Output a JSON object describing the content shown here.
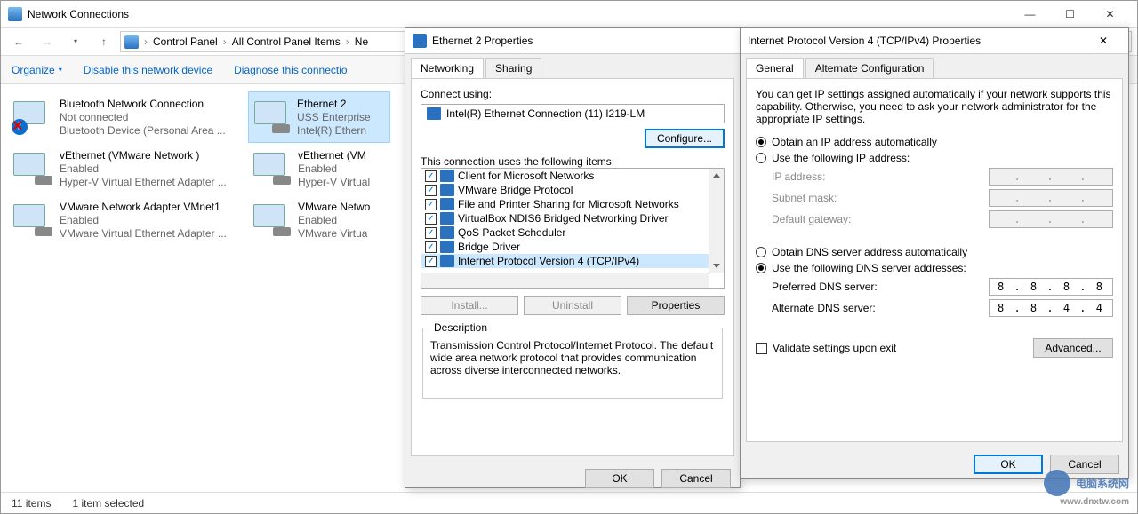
{
  "window": {
    "title": "Network Connections",
    "breadcrumb": [
      "Control Panel",
      "All Control Panel Items",
      "Ne"
    ],
    "cmdbar": {
      "organize": "Organize",
      "disable": "Disable this network device",
      "diagnose": "Diagnose this connectio"
    },
    "status": {
      "count": "11 items",
      "selected": "1 item selected"
    }
  },
  "adapters": [
    {
      "name": "Bluetooth Network Connection",
      "status": "Not connected",
      "device": "Bluetooth Device (Personal Area ...",
      "overlay": "btx"
    },
    {
      "name": "vEthernet (VMware Network )",
      "status": "Enabled",
      "device": "Hyper-V Virtual Ethernet Adapter ..."
    },
    {
      "name": "VMware Network Adapter VMnet1",
      "status": "Enabled",
      "device": "VMware Virtual Ethernet Adapter ..."
    },
    {
      "name": "Ethernet 2",
      "status": "USS Enterprise",
      "device": "Intel(R) Ethern",
      "selected": true
    },
    {
      "name": "vEthernet (VM",
      "status": "Enabled",
      "device": "Hyper-V Virtual"
    },
    {
      "name": "VMware Netwo",
      "status": "Enabled",
      "device": "VMware Virtua"
    }
  ],
  "ethprop": {
    "title": "Ethernet 2 Properties",
    "tabs": [
      "Networking",
      "Sharing"
    ],
    "connect_label": "Connect using:",
    "adapter": "Intel(R) Ethernet Connection (11) I219-LM",
    "configure": "Configure...",
    "items_label": "This connection uses the following items:",
    "items": [
      "Client for Microsoft Networks",
      "VMware Bridge Protocol",
      "File and Printer Sharing for Microsoft Networks",
      "VirtualBox NDIS6 Bridged Networking Driver",
      "QoS Packet Scheduler",
      "Bridge Driver",
      "Internet Protocol Version 4 (TCP/IPv4)"
    ],
    "selected_item": 6,
    "btns": {
      "install": "Install...",
      "uninstall": "Uninstall",
      "properties": "Properties"
    },
    "desc_label": "Description",
    "desc": "Transmission Control Protocol/Internet Protocol. The default wide area network protocol that provides communication across diverse interconnected networks.",
    "ok": "OK",
    "cancel": "Cancel"
  },
  "ipv4": {
    "title": "Internet Protocol Version 4 (TCP/IPv4) Properties",
    "tabs": [
      "General",
      "Alternate Configuration"
    ],
    "intro": "You can get IP settings assigned automatically if your network supports this capability. Otherwise, you need to ask your network administrator for the appropriate IP settings.",
    "ip_auto": "Obtain an IP address automatically",
    "ip_manual": "Use the following IP address:",
    "ip_fields": {
      "ip": "IP address:",
      "mask": "Subnet mask:",
      "gw": "Default gateway:"
    },
    "dns_auto": "Obtain DNS server address automatically",
    "dns_manual": "Use the following DNS server addresses:",
    "dns_fields": {
      "pref": "Preferred DNS server:",
      "alt": "Alternate DNS server:"
    },
    "dns_pref_val": "8 . 8 . 8 . 8",
    "dns_alt_val": "8 . 8 . 4 . 4",
    "validate": "Validate settings upon exit",
    "advanced": "Advanced...",
    "ok": "OK",
    "cancel": "Cancel"
  },
  "watermark": {
    "text": "电脑系统网",
    "sub": "www.dnxtw.com"
  }
}
